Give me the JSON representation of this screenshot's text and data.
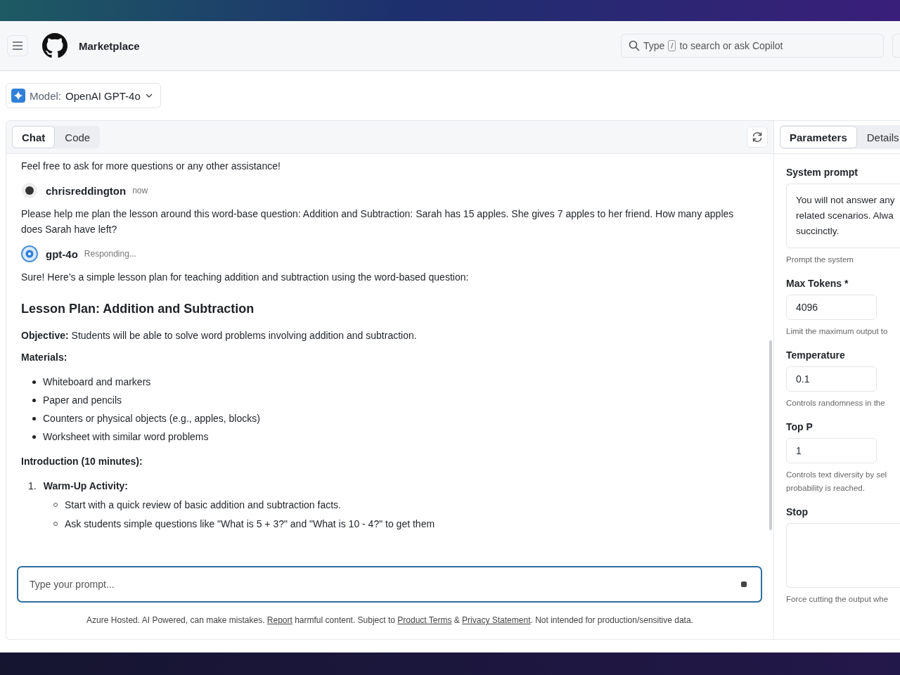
{
  "header": {
    "title": "Marketplace",
    "search": {
      "parts": [
        {
          "kind": "text",
          "text": "Type"
        },
        {
          "kind": "key",
          "text": "/"
        },
        {
          "kind": "text",
          "text": "to search or ask Copilot"
        }
      ]
    }
  },
  "model_picker": {
    "label": "Model:",
    "value": "OpenAI GPT-4o"
  },
  "tabs": [
    {
      "label": "Chat",
      "selected": true
    },
    {
      "label": "Code",
      "selected": false
    }
  ],
  "chat": {
    "blocks": [
      {
        "kind": "paragraph",
        "text": "Feel free to ask for more questions or any other assistance!"
      },
      {
        "kind": "user_author",
        "name": "chrisreddington",
        "meta": "now"
      },
      {
        "kind": "paragraph",
        "text": "Please help me plan the lesson around this word-base question: Addition and Subtraction: Sarah has 15 apples. She gives 7 apples to her friend. How many apples does Sarah have left?"
      },
      {
        "kind": "bot_author",
        "name": "gpt-4o",
        "meta": "Responding..."
      },
      {
        "kind": "paragraph",
        "text": "Sure! Here’s a simple lesson plan for teaching addition and subtraction using the word-based question:"
      },
      {
        "kind": "heading",
        "text": "Lesson Plan: Addition and Subtraction"
      },
      {
        "kind": "paragraph",
        "text": "**Objective:** Students will be able to solve word problems involving addition and subtraction."
      },
      {
        "kind": "label",
        "text": "Materials:"
      },
      {
        "kind": "bullets",
        "items": [
          {
            "text": "Whiteboard and markers"
          },
          {
            "text": "Paper and pencils"
          },
          {
            "text": "Counters or physical objects (e.g., apples, blocks)"
          },
          {
            "text": "Worksheet with similar word problems"
          }
        ]
      },
      {
        "kind": "label",
        "text": "Introduction (10 minutes):"
      },
      {
        "kind": "numbered",
        "items": [
          {
            "number": "1.",
            "text": "Warm-Up Activity:",
            "children": [
              {
                "text": "Start with a quick review of basic addition and subtraction facts."
              },
              {
                "text": "Ask students simple questions like \"What is 5 + 3?\" and \"What is 10 - 4?\" to get them"
              }
            ]
          }
        ]
      }
    ]
  },
  "prompt": {
    "placeholder": "Type your prompt..."
  },
  "disclaimer": [
    {
      "kind": "text",
      "text": "Azure Hosted. AI Powered, can make mistakes. "
    },
    {
      "kind": "link",
      "text": "Report"
    },
    {
      "kind": "text",
      "text": " harmful content. Subject to "
    },
    {
      "kind": "link",
      "text": "Product Terms"
    },
    {
      "kind": "text",
      "text": " & "
    },
    {
      "kind": "link",
      "text": "Privacy Statement"
    },
    {
      "kind": "text",
      "text": ". Not intended for production/sensitive data."
    }
  ],
  "side_tabs": [
    {
      "label": "Parameters",
      "selected": true
    },
    {
      "label": "Details",
      "selected": false
    }
  ],
  "parameters": [
    {
      "kind": "textarea",
      "label": "System prompt",
      "value": [
        "You will not answer any",
        "related scenarios. Alwa",
        "succinctly."
      ],
      "hint": [
        "Prompt the system"
      ]
    },
    {
      "kind": "number",
      "label": "Max Tokens *",
      "value": "4096",
      "hint": [
        "Limit the maximum output to"
      ]
    },
    {
      "kind": "number",
      "label": "Temperature",
      "value": "0.1",
      "hint": [
        "Controls randomness in the"
      ]
    },
    {
      "kind": "number",
      "label": "Top P",
      "value": "1",
      "hint": [
        "Controls text diversity by sel",
        "probability is reached."
      ]
    },
    {
      "kind": "empty",
      "label": "Stop",
      "hint": [
        "Force cutting the output whe"
      ]
    }
  ]
}
